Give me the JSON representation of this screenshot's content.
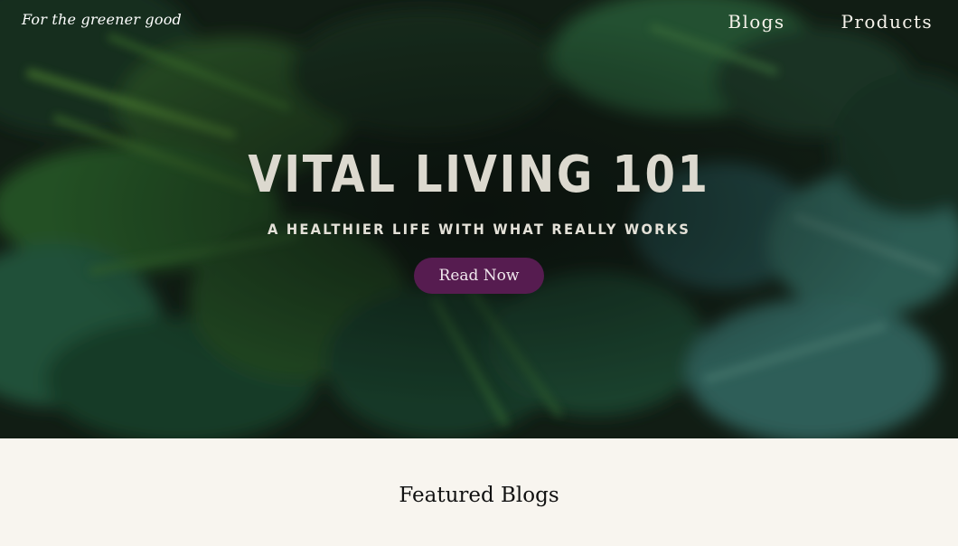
{
  "header": {
    "brand": "For the greener good",
    "nav": [
      {
        "label": "Blogs"
      },
      {
        "label": "Products"
      }
    ]
  },
  "hero": {
    "title": "VITAL LIVING 101",
    "subtitle": "A HEALTHIER LIFE WITH WHAT REALLY WORKS",
    "cta_label": "Read Now"
  },
  "featured": {
    "title": "Featured Blogs"
  },
  "colors": {
    "button": "#561c50",
    "page_background": "#f8f5ef",
    "title_text": "#dcd9cf"
  }
}
